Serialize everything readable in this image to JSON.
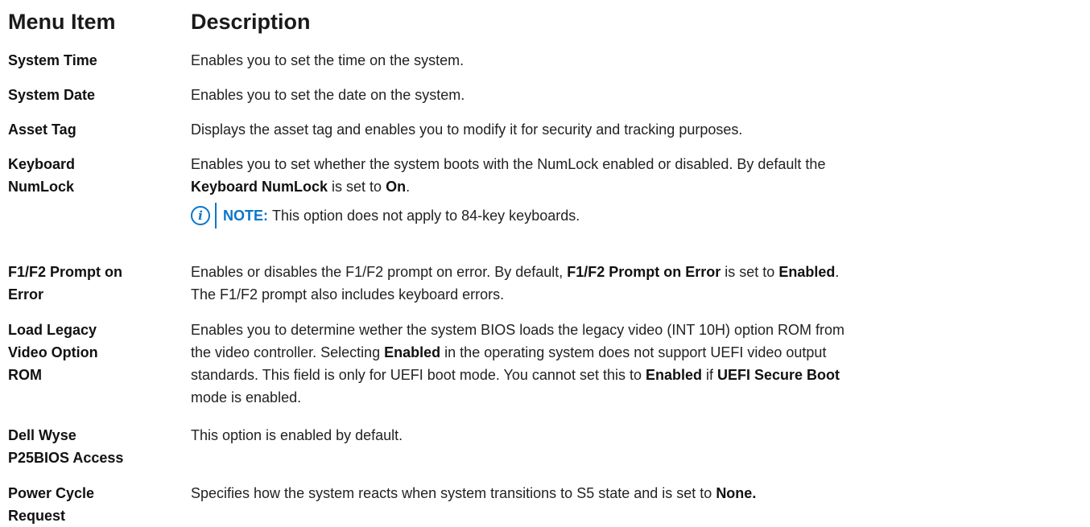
{
  "header": {
    "menu_item": "Menu Item",
    "description": "Description"
  },
  "rows": [
    {
      "item": "System Time",
      "desc": "Enables you to set the time on the system."
    },
    {
      "item": "System Date",
      "desc": "Enables you to set the date on the system."
    },
    {
      "item": "Asset Tag",
      "desc": "Displays the asset tag and enables you to modify it for security and tracking purposes."
    },
    {
      "item_l1": "Keyboard",
      "item_l2": "NumLock",
      "desc_a": "Enables you to set whether the system boots with the NumLock enabled or disabled. By default the ",
      "desc_b1": "Keyboard NumLock",
      "desc_c": " is set to ",
      "desc_b2": "On",
      "desc_d": ".",
      "note_label": "NOTE:",
      "note_text": "This option does not apply to 84-key keyboards."
    },
    {
      "item_l1": "F1/F2 Prompt on",
      "item_l2": "Error",
      "desc_a": "Enables or disables the F1/F2 prompt on error. By default, ",
      "desc_b1": "F1/F2 Prompt on Error",
      "desc_c": " is set to ",
      "desc_b2": "Enabled",
      "desc_d": ".",
      "line2": "The F1/F2 prompt also includes keyboard errors."
    },
    {
      "item_l1": "Load Legacy",
      "item_l2": "Video Option",
      "item_l3": "ROM",
      "l1": "Enables you to determine wether the system BIOS loads the legacy video (INT 10H) option ROM from",
      "l2a": "the video controller. Selecting ",
      "l2b": "Enabled",
      "l2c": " in the operating system does not support UEFI video output",
      "l3": "standards. This field is only for UEFI boot mode. You cannot set this to ",
      "l3b": "Enabled",
      "l3c": " if ",
      "l3d": "UEFI Secure Boot",
      "l4": "mode is enabled."
    },
    {
      "item_l1": "Dell Wyse",
      "item_l2": "P25BIOS Access",
      "desc": "This option is enabled by default."
    },
    {
      "item_l1": "Power Cycle",
      "item_l2": "Request",
      "desc_a": "Specifies how the system reacts when system transitions to S5 state and is set to ",
      "desc_b1": "None."
    }
  ],
  "icons": {
    "note": "info-icon"
  },
  "colors": {
    "accent": "#0a76c9"
  }
}
